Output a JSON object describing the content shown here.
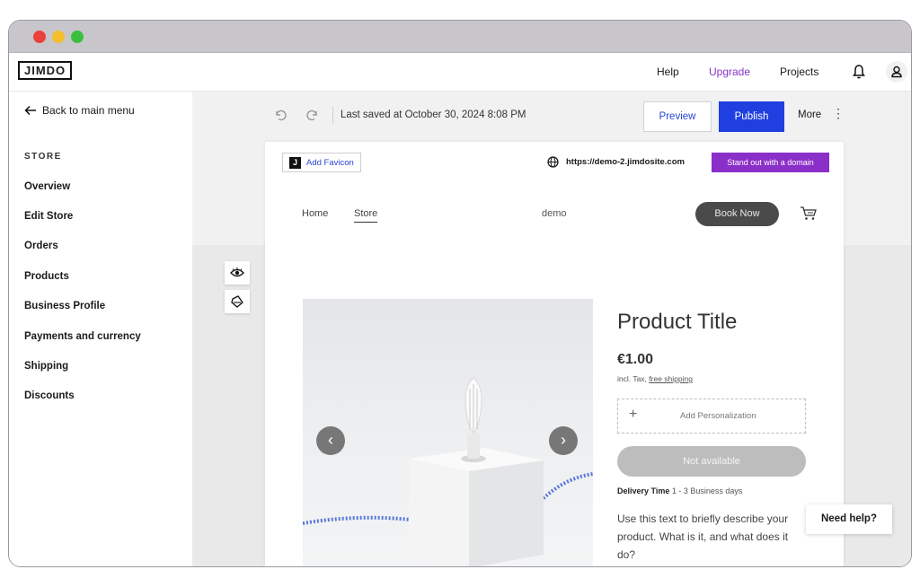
{
  "window": {
    "controls": [
      "close",
      "minimize",
      "maximize"
    ],
    "colors": {
      "close": "#e9423a",
      "minimize": "#f4be2c",
      "maximize": "#3ac03e"
    }
  },
  "topbar": {
    "logo": "JIMDO",
    "help": "Help",
    "upgrade": "Upgrade",
    "projects": "Projects",
    "icons": [
      "bell-icon",
      "user-icon"
    ],
    "upgrade_color": "#8a36c9"
  },
  "sidebar": {
    "back_label": "Back to main menu",
    "section_title": "STORE",
    "items": [
      {
        "label": "Overview"
      },
      {
        "label": "Edit Store"
      },
      {
        "label": "Orders"
      },
      {
        "label": "Products"
      },
      {
        "label": "Business Profile"
      },
      {
        "label": "Payments and currency"
      },
      {
        "label": "Shipping"
      },
      {
        "label": "Discounts"
      }
    ]
  },
  "toolbar": {
    "saved_text": "Last saved at October 30, 2024 8:08 PM",
    "preview_label": "Preview",
    "publish_label": "Publish",
    "more_label": "More",
    "publish_color": "#1f3fe0"
  },
  "site": {
    "favicon_label": "Add Favicon",
    "favicon_letter": "J",
    "url": "https://demo-2.jimdosite.com",
    "domain_button": "Stand out with a domain",
    "domain_color": "#8b2fc9",
    "nav": {
      "home": "Home",
      "store": "Store",
      "name": "demo",
      "book_now": "Book Now"
    }
  },
  "product": {
    "title": "Product Title",
    "price": "€1.00",
    "tax_prefix": "incl. Tax,",
    "tax_link": "free shipping",
    "personalization": "Add Personalization",
    "availability": "Not available",
    "delivery_label": "Delivery Time",
    "delivery_value": "1 - 3 Business days",
    "description": "Use this text to briefly describe your product. What is it, and what does it do?"
  },
  "help_widget": {
    "label": "Need help?"
  }
}
